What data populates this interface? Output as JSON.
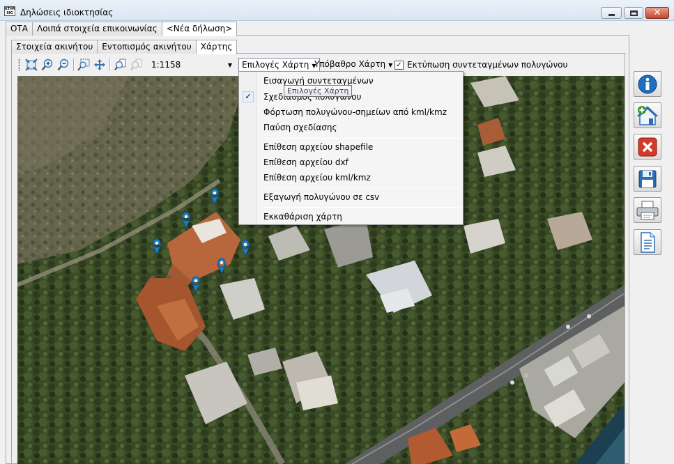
{
  "window": {
    "title": "Δηλώσεις ιδιοκτησίας",
    "logo_text": "KTIMA SIG"
  },
  "tabs_top": [
    {
      "label": "ΟΤΑ",
      "active": false
    },
    {
      "label": "Λοιπά στοιχεία επικοινωνίας",
      "active": false
    },
    {
      "label": "<Νέα δήλωση>",
      "active": true
    }
  ],
  "tabs_sub": [
    {
      "label": "Στοιχεία ακινήτου",
      "active": false
    },
    {
      "label": "Εντοπισμός ακινήτου",
      "active": false
    },
    {
      "label": "Χάρτης",
      "active": true
    }
  ],
  "toolbar": {
    "scale": "1:1158",
    "map_options_label": "Επιλογές Χάρτη",
    "basemap_label": "Υπόβαθρο Χάρτη",
    "print_coords_label": "Εκτύπωση συντεταγμένων πολυγώνου",
    "print_coords_checked": true
  },
  "menu": {
    "items": [
      {
        "label": "Εισαγωγή συντεταγμένων",
        "checked": false
      },
      {
        "label": "Σχεδιασμός πολυγώνου",
        "checked": true
      },
      {
        "label": "Φόρτωση πολυγώνου-σημείων από kml/kmz",
        "checked": false
      },
      {
        "label": "Παύση σχεδίασης",
        "checked": false
      },
      {
        "label": "Επίθεση αρχείου shapefile",
        "checked": false
      },
      {
        "label": "Επίθεση αρχείου dxf",
        "checked": false
      },
      {
        "label": "Επίθεση αρχείου kml/kmz",
        "checked": false
      },
      {
        "label": "Εξαγωγή πολυγώνου σε csv",
        "checked": false
      },
      {
        "label": "Εκκαθάριση χάρτη",
        "checked": false
      }
    ],
    "tooltip": "Επιλογές Χάρτη"
  },
  "side_buttons": [
    "info-icon",
    "add-property-icon",
    "delete-icon",
    "save-icon",
    "print-icon",
    "document-icon"
  ],
  "colors": {
    "marker": "#1f7fc4",
    "titlebar": "#dbe6f3",
    "close_button": "#c8452c"
  }
}
